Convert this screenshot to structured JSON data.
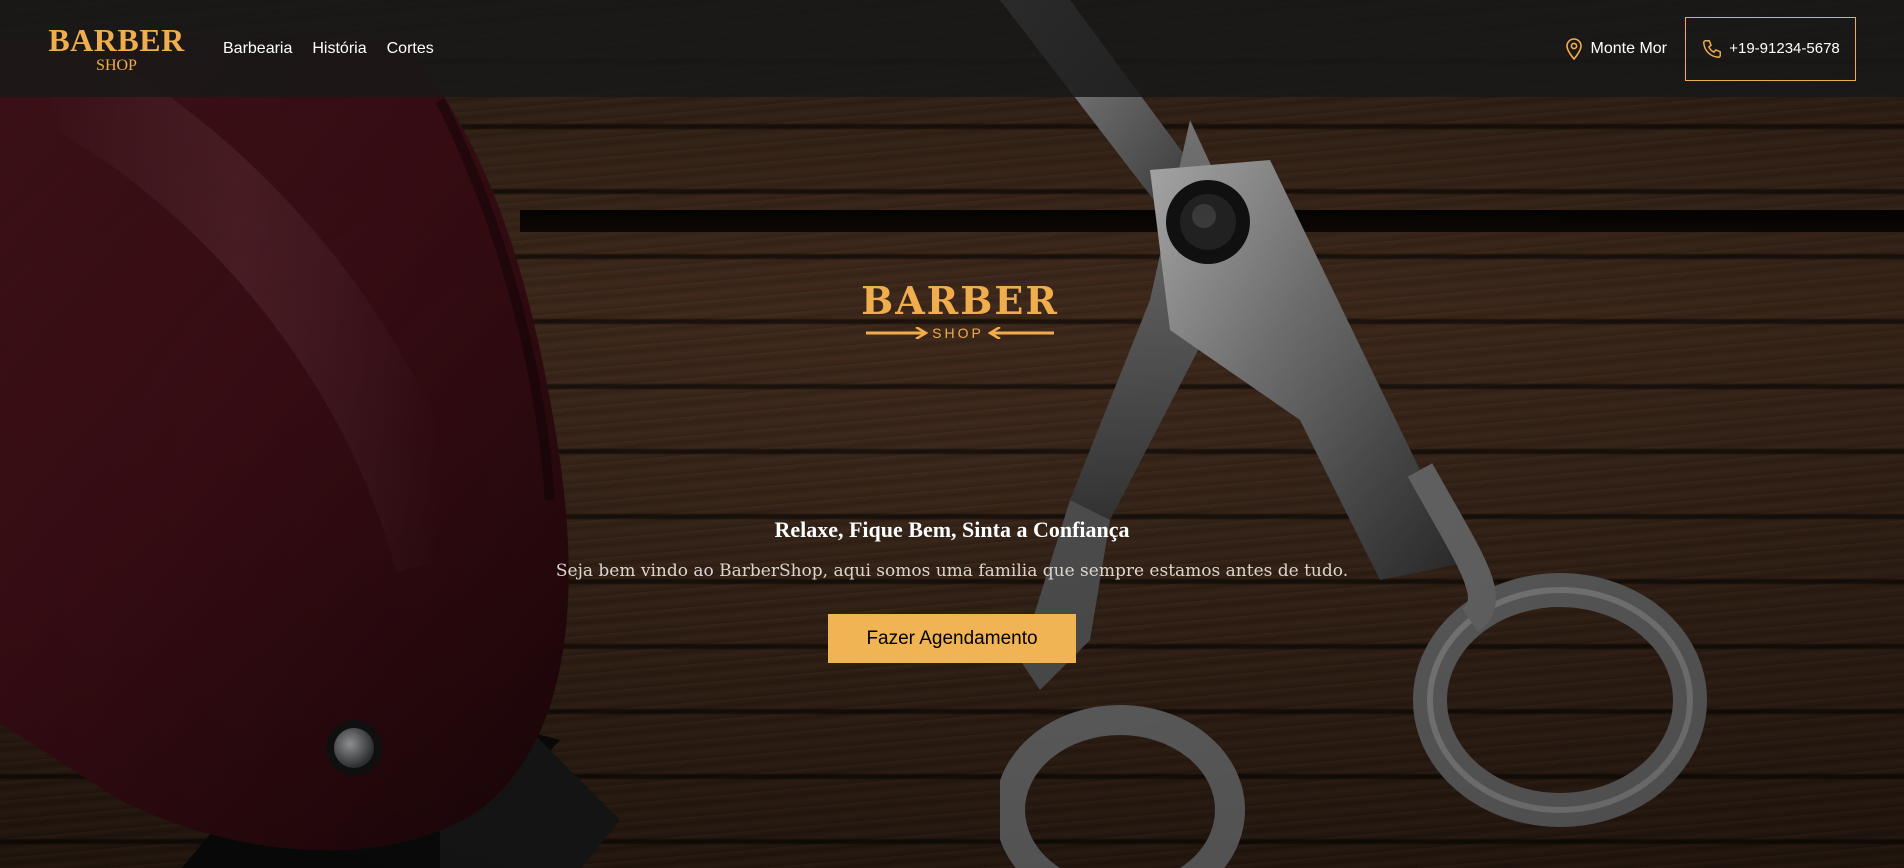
{
  "brand": {
    "name": "BARBER",
    "sub": "SHOP"
  },
  "nav": {
    "links": [
      {
        "label": "Barbearia"
      },
      {
        "label": "História"
      },
      {
        "label": "Cortes"
      }
    ],
    "location": "Monte Mor",
    "phone": "+19-91234-5678",
    "location_icon": "map-pin-icon",
    "phone_icon": "phone-icon"
  },
  "hero": {
    "logo_main": "BARBER",
    "logo_sub": "SHOP",
    "title": "Relaxe, Fique Bem, Sinta a Confiança",
    "subtitle": "Seja bem vindo ao BarberShop, aqui somos uma familia que sempre estamos antes de tudo.",
    "cta_label": "Fazer Agendamento"
  },
  "colors": {
    "accent": "#f0ad4e",
    "cta": "#f0b454",
    "navbar": "#181818"
  }
}
